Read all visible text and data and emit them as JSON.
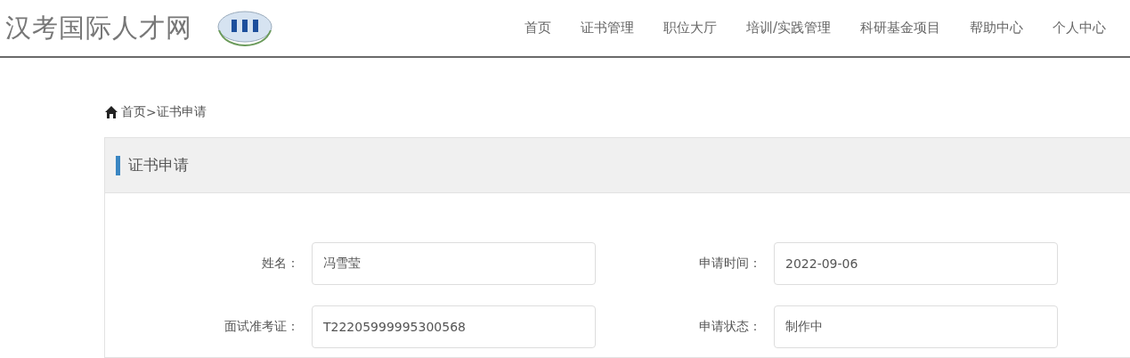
{
  "header": {
    "site_title": "汉考国际人才网",
    "nav": [
      {
        "label": "首页"
      },
      {
        "label": "证书管理"
      },
      {
        "label": "职位大厅"
      },
      {
        "label": "培训/实践管理"
      },
      {
        "label": "科研基金项目"
      },
      {
        "label": "帮助中心"
      },
      {
        "label": "个人中心"
      }
    ]
  },
  "breadcrumb": {
    "home": "首页",
    "separator": ">",
    "current": "证书申请"
  },
  "panel": {
    "title": "证书申请",
    "fields": [
      {
        "label": "姓名：",
        "value": "冯雪莹"
      },
      {
        "label": "申请时间：",
        "value": "2022-09-06"
      },
      {
        "label": "面试准考证：",
        "value": "T22205999995300568"
      },
      {
        "label": "申请状态：",
        "value": "制作中"
      }
    ]
  }
}
